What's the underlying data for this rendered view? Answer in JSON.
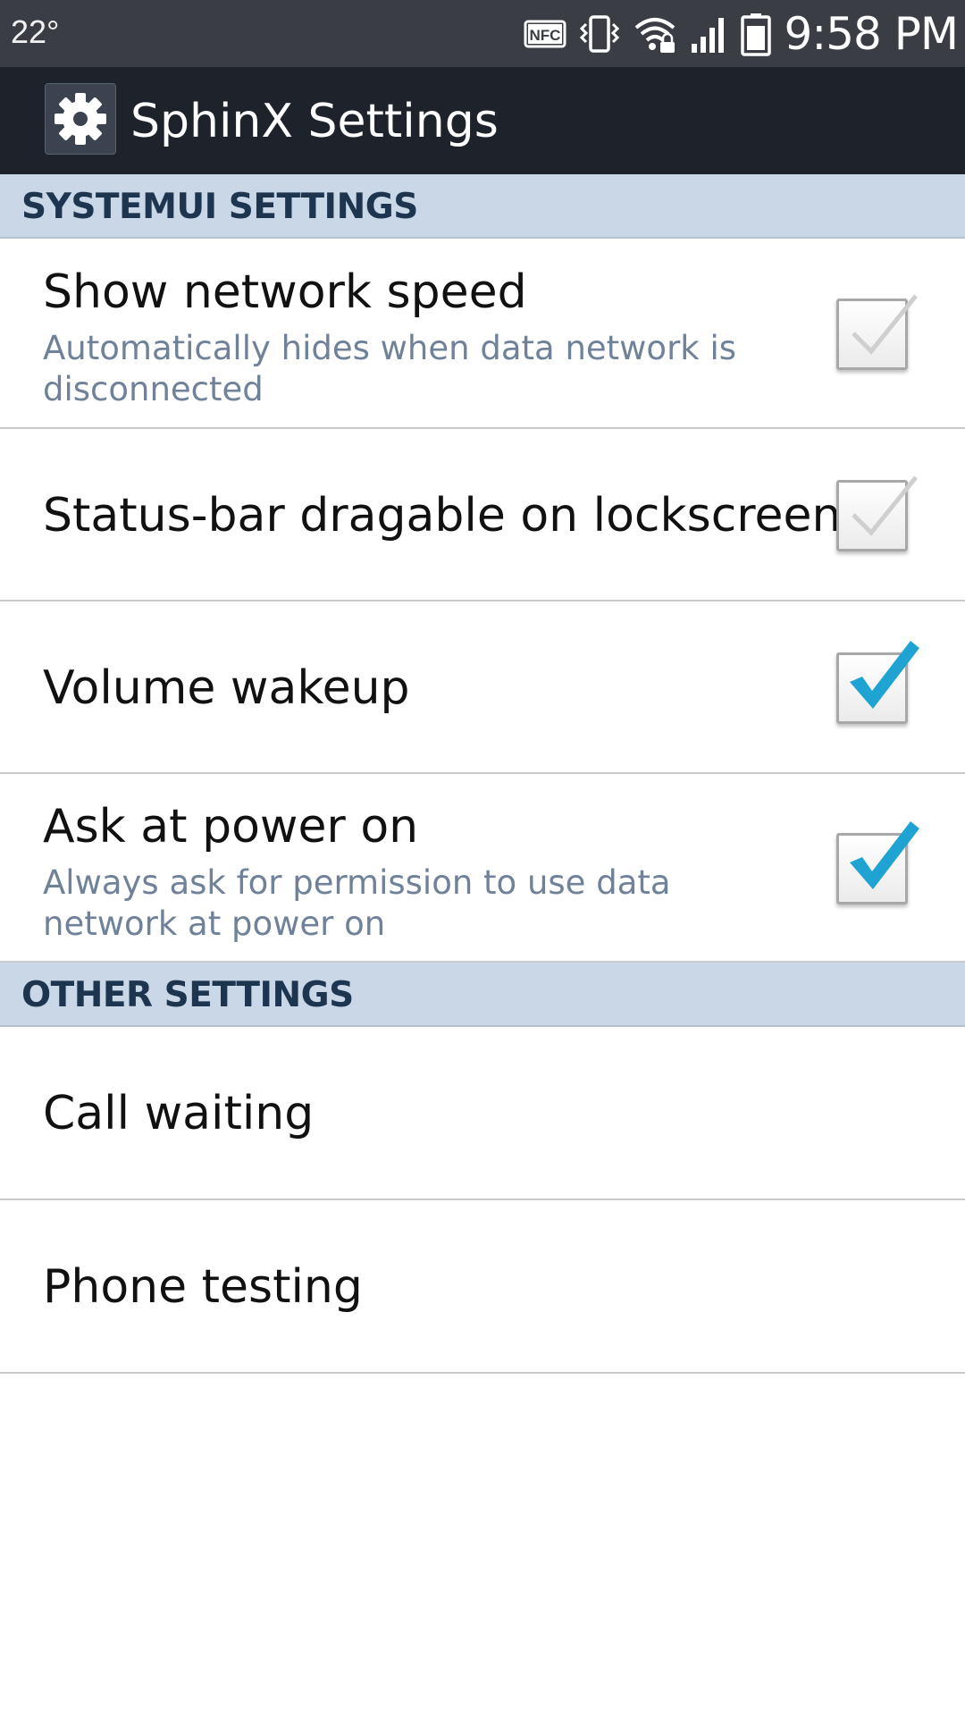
{
  "status_bar": {
    "temperature": "22°",
    "time": "9:58 PM",
    "icons": [
      "nfc-icon",
      "vibrate-icon",
      "wifi-lock-icon",
      "signal-icon",
      "battery-icon"
    ]
  },
  "action_bar": {
    "icon": "settings-gear-icon",
    "title": "SphinX Settings"
  },
  "sections": [
    {
      "header": "SYSTEMUI SETTINGS",
      "items": [
        {
          "title": "Show network speed",
          "summary": "Automatically hides when data network is disconnected",
          "checked": false
        },
        {
          "title": "Status-bar dragable on lockscreen",
          "checked": false
        },
        {
          "title": "Volume wakeup",
          "checked": true
        },
        {
          "title": "Ask at power on",
          "summary": "Always ask for permission to use data network at power on",
          "checked": true
        }
      ]
    },
    {
      "header": "OTHER SETTINGS",
      "items": [
        {
          "title": "Call waiting"
        },
        {
          "title": "Phone testing"
        }
      ]
    }
  ],
  "colors": {
    "status_bar": "#3a3d44",
    "action_bar": "#1d222b",
    "section_header_bg": "#c9d7e6",
    "section_header_text": "#1e3550",
    "summary_text": "#6f8299",
    "check_accent": "#1ea3d3",
    "check_inactive": "#cccccc"
  }
}
